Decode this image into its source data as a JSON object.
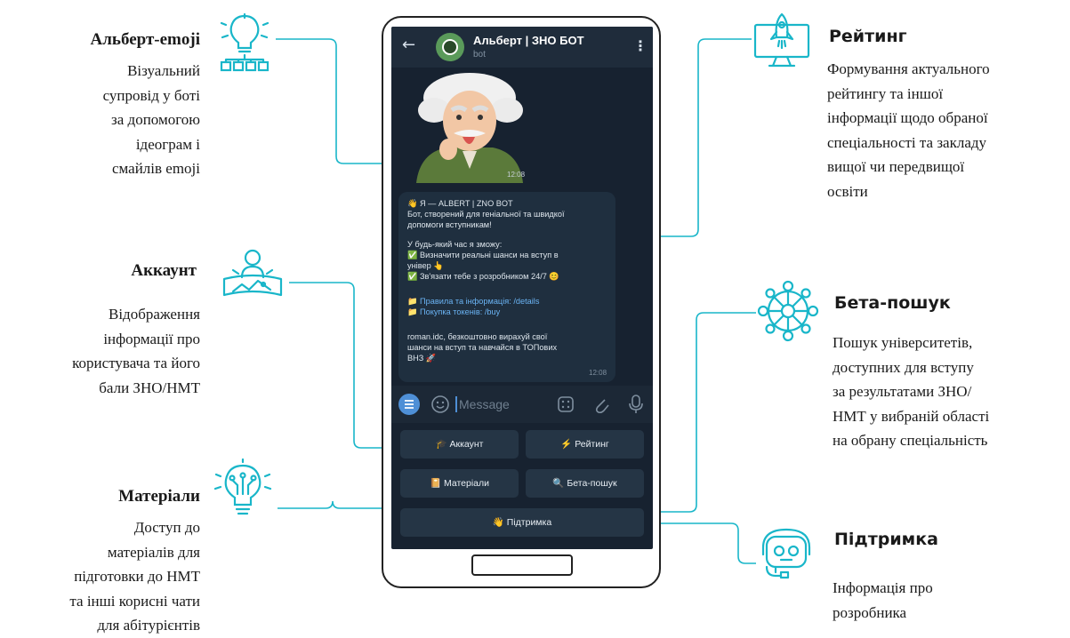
{
  "left_features": [
    {
      "title": "Альберт-emoji",
      "desc": [
        "Візуальний",
        "супровід  у боті",
        "за допомогою",
        "ідеограм і",
        "смайлів emoji"
      ],
      "icon": "lightbulb-network-icon"
    },
    {
      "title": "Аккаунт",
      "desc": [
        "Відображення",
        "інформації про",
        "користувача та його",
        "бали ЗНО/НМТ"
      ],
      "icon": "user-profile-icon"
    },
    {
      "title": "Матеріали",
      "desc": [
        "Доступ до",
        "матеріалів для",
        "підготовки до НМТ",
        "та інші корисні чати",
        "для абітурієнтів"
      ],
      "icon": "lightbulb-circuit-icon"
    }
  ],
  "right_features": [
    {
      "title": "Рейтинг",
      "desc": [
        "Формування актуального",
        "рейтингу та іншої",
        "інформації щодо обраної",
        "спеціальності та закладу",
        "вищої чи передвищої",
        "освіти"
      ],
      "icon": "rocket-monitor-icon"
    },
    {
      "title": "Бета-пошук",
      "desc": [
        "Пошук університетів,",
        "доступних для вступу",
        "за результатами ЗНО/",
        "НМТ у вибраній області",
        "на обрану спеціальність"
      ],
      "icon": "network-wheel-icon"
    },
    {
      "title": "Підтримка",
      "desc": [
        "Інформація про",
        "розробника"
      ],
      "icon": "support-headset-icon"
    }
  ],
  "chat": {
    "header": {
      "back": "←",
      "title": "Альберт | ЗНО БОТ",
      "subtitle": "bot",
      "menu": "⋮"
    },
    "sticker_time": "12:08",
    "message": {
      "lines": [
        "👋 Я — ALBERT | ZNO BOT",
        "Бот, створений для геніальної та швидкої",
        "допомоги вступникам!",
        "",
        "У будь-який час я зможу:",
        "✅ Визначити реальні шанси на вступ в",
        "універ 👆",
        "✅ Зв'язати тебе з розробником 24/7 😊",
        "",
        "📁 Правила та інформація: /details",
        "📁 Покупка токенів: /buy",
        "",
        "roman.idc, безкоштовно вирахуй свої",
        "шанси на вступ та навчайся в ТОПових",
        "ВНЗ 🚀"
      ],
      "time": "12:08"
    },
    "input": {
      "placeholder": "Message"
    },
    "keyboard": {
      "account": "🎓 Аккаунт",
      "rating": "⚡ Рейтинг",
      "materials": "📔 Матеріали",
      "beta_search": "🔍 Бета-пошук",
      "support": "👋 Підтримка"
    }
  },
  "colors": {
    "accent": "#19b6c9",
    "screen_bg": "#172230",
    "button_bg": "#253545"
  }
}
